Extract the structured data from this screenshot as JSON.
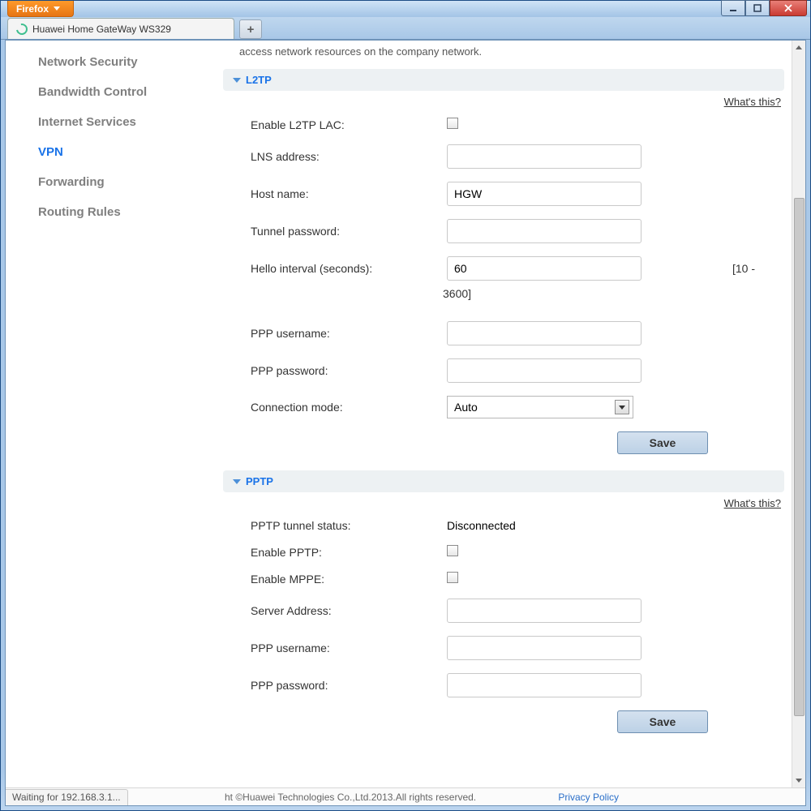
{
  "browser": {
    "menu_label": "Firefox",
    "tab_title": "Huawei Home GateWay WS329",
    "new_tab_glyph": "+",
    "status_text": "Waiting for 192.168.3.1..."
  },
  "nav": {
    "items": [
      {
        "label": "Network Security",
        "active": false
      },
      {
        "label": "Bandwidth Control",
        "active": false
      },
      {
        "label": "Internet Services",
        "active": false
      },
      {
        "label": "VPN",
        "active": true
      },
      {
        "label": "Forwarding",
        "active": false
      },
      {
        "label": "Routing Rules",
        "active": false
      }
    ]
  },
  "page": {
    "truncated_top_text": "access network resources on the company network.",
    "whats_this": "What's this?",
    "save_label": "Save"
  },
  "l2tp": {
    "title": "L2TP",
    "fields": {
      "enable_label": "Enable L2TP LAC:",
      "enable_checked": false,
      "lns_label": "LNS address:",
      "lns_value": "",
      "host_label": "Host name:",
      "host_value": "HGW",
      "tunnel_pw_label": "Tunnel password:",
      "tunnel_pw_value": "",
      "hello_label": "Hello interval (seconds):",
      "hello_value": "60",
      "hello_range_suffix": "[10 -",
      "hello_range_below": "3600]",
      "ppp_user_label": "PPP username:",
      "ppp_user_value": "",
      "ppp_pw_label": "PPP password:",
      "ppp_pw_value": "",
      "conn_mode_label": "Connection mode:",
      "conn_mode_value": "Auto"
    }
  },
  "pptp": {
    "title": "PPTP",
    "fields": {
      "status_label": "PPTP tunnel status:",
      "status_value": "Disconnected",
      "enable_pptp_label": "Enable PPTP:",
      "enable_pptp_checked": false,
      "enable_mppe_label": "Enable MPPE:",
      "enable_mppe_checked": false,
      "server_label": "Server Address:",
      "server_value": "",
      "ppp_user_label": "PPP username:",
      "ppp_user_value": "",
      "ppp_pw_label": "PPP password:",
      "ppp_pw_value": ""
    }
  },
  "footer": {
    "copyright": "ht ©Huawei Technologies Co.,Ltd.2013.All rights reserved.",
    "privacy": "Privacy Policy"
  }
}
